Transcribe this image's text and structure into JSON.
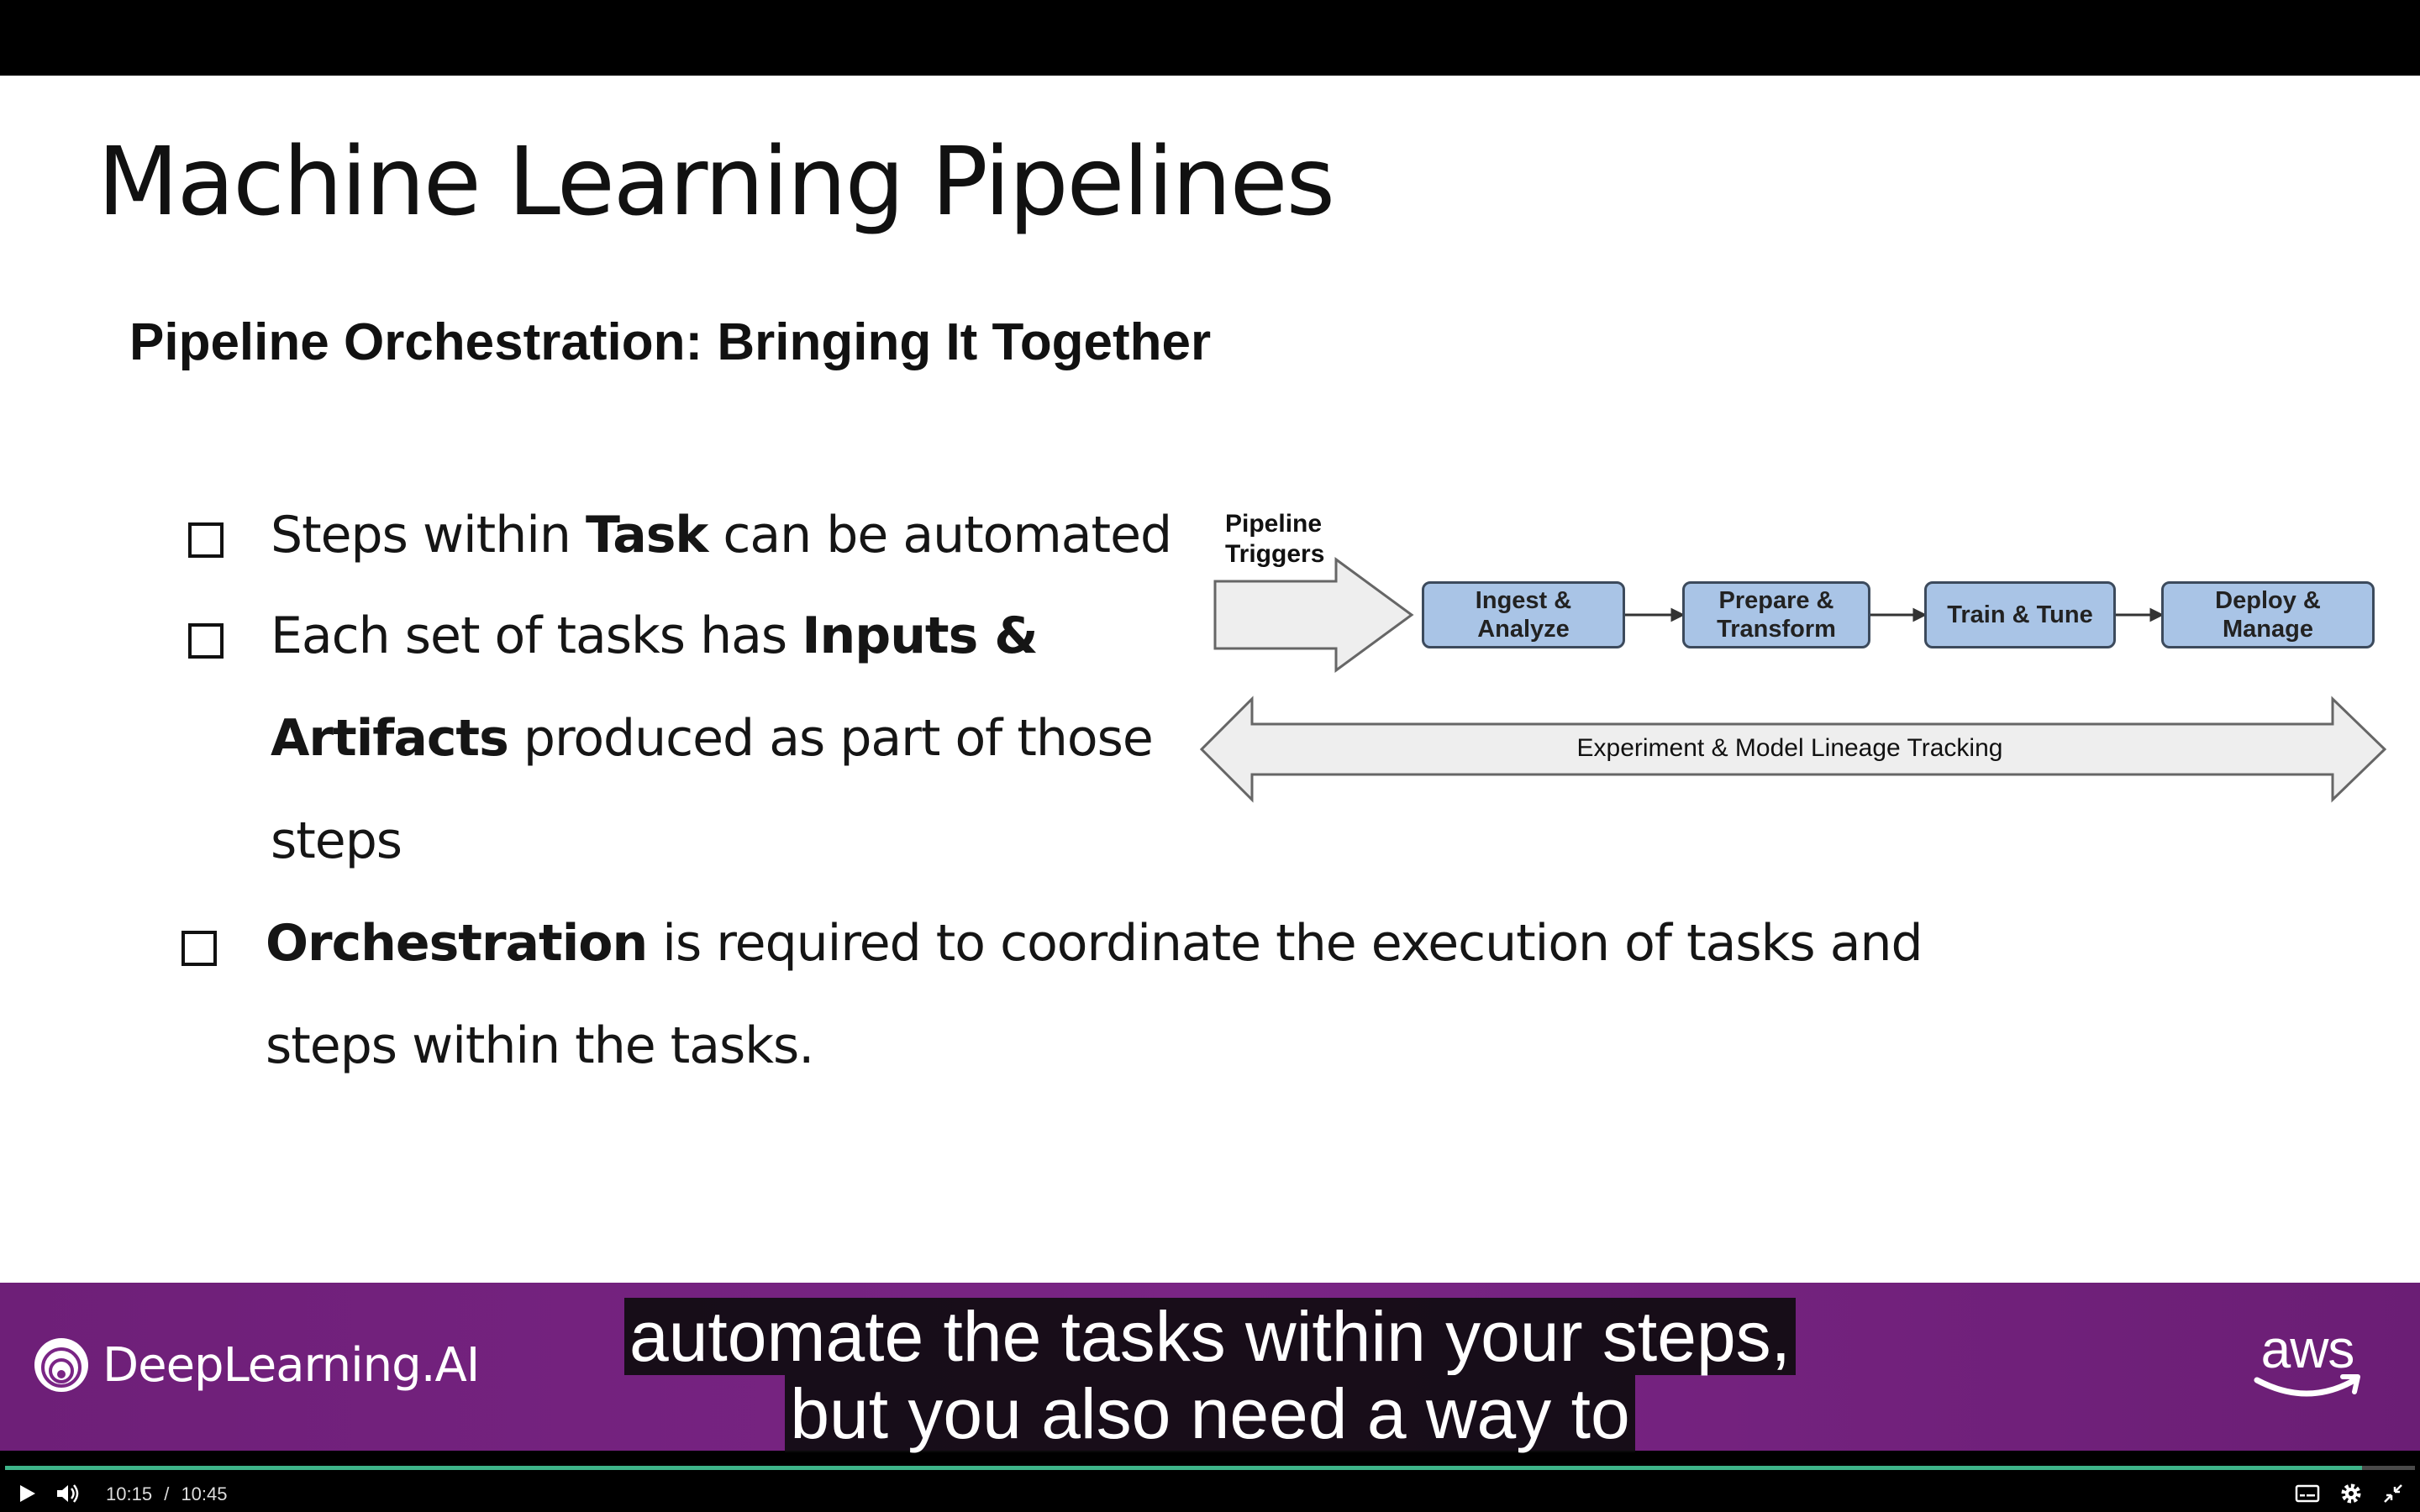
{
  "slide": {
    "title": "Machine Learning Pipelines",
    "subtitle": "Pipeline Orchestration: Bringing It Together",
    "bullets": [
      {
        "line1_pre": "Steps within ",
        "line1_bold": "Task",
        "line1_post": " can be automated"
      },
      {
        "line1_pre": "Each set of tasks has ",
        "line1_bold": "Inputs &",
        "line2_bold": "Artifacts",
        "line2_post": " produced as part of those",
        "line3": "steps"
      },
      {
        "line1_bold": "Orchestration",
        "line1_post": " is required to coordinate the execution of tasks and",
        "line2": "steps within the tasks."
      }
    ],
    "diagram": {
      "trigger": [
        "Pipeline",
        "Triggers"
      ],
      "steps": [
        [
          "Ingest &",
          "Analyze"
        ],
        [
          "Prepare &",
          "Transform"
        ],
        [
          "Train & Tune"
        ],
        [
          "Deploy &",
          "Manage"
        ]
      ],
      "lineage": "Experiment & Model Lineage Tracking"
    }
  },
  "banner": {
    "brand": "DeepLearning.AI",
    "partner": "aws"
  },
  "captions": {
    "line1": "automate the tasks within your steps,",
    "line2": "but you also need a way to"
  },
  "player": {
    "current_time": "10:15",
    "separator": "/",
    "duration": "10:45",
    "progress": 0.978,
    "accent_color": "#3eb489"
  }
}
